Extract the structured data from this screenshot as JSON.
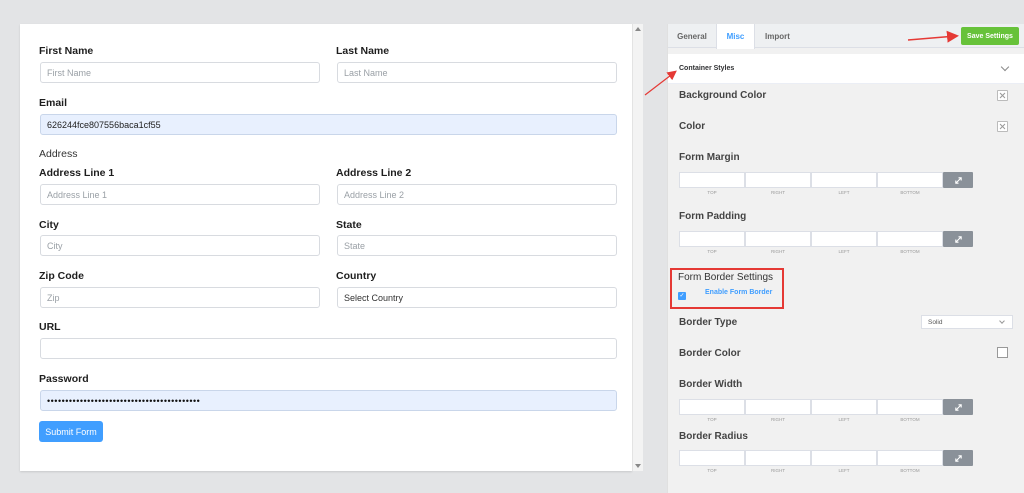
{
  "form": {
    "first_name": {
      "label": "First Name",
      "placeholder": "First Name"
    },
    "last_name": {
      "label": "Last Name",
      "placeholder": "Last Name"
    },
    "email": {
      "label": "Email",
      "value": "626244fce807556baca1cf55"
    },
    "address_section": "Address",
    "address_line_1": {
      "label": "Address Line 1",
      "placeholder": "Address Line 1"
    },
    "address_line_2": {
      "label": "Address Line 2",
      "placeholder": "Address Line 2"
    },
    "city": {
      "label": "City",
      "placeholder": "City"
    },
    "state": {
      "label": "State",
      "placeholder": "State"
    },
    "zip": {
      "label": "Zip Code",
      "placeholder": "Zip"
    },
    "country": {
      "label": "Country",
      "value": "Select Country"
    },
    "url": {
      "label": "URL",
      "value": ""
    },
    "password": {
      "label": "Password",
      "value": "••••••••••••••••••••••••••••••••••••••••••"
    },
    "submit_label": "Submit Form"
  },
  "panel": {
    "tabs": [
      {
        "label": "General"
      },
      {
        "label": "Misc"
      },
      {
        "label": "Import"
      }
    ],
    "active_tab": "Misc",
    "save_label": "Save Settings",
    "section_title": "Container Styles",
    "background_color_label": "Background Color",
    "color_label": "Color",
    "form_margin_label": "Form Margin",
    "form_padding_label": "Form Padding",
    "spacing_captions": [
      "TOP",
      "RIGHT",
      "LEFT",
      "BOTTOM"
    ],
    "border_settings_title": "Form Border Settings",
    "enable_border_label": "Enable Form Border",
    "border_type_label": "Border Type",
    "border_type_value": "Solid",
    "border_color_label": "Border Color",
    "border_width_label": "Border Width",
    "border_radius_label": "Border Radius"
  },
  "colors": {
    "accent": "#409eff",
    "save_button": "#67c23a",
    "annotation": "#e53935"
  }
}
